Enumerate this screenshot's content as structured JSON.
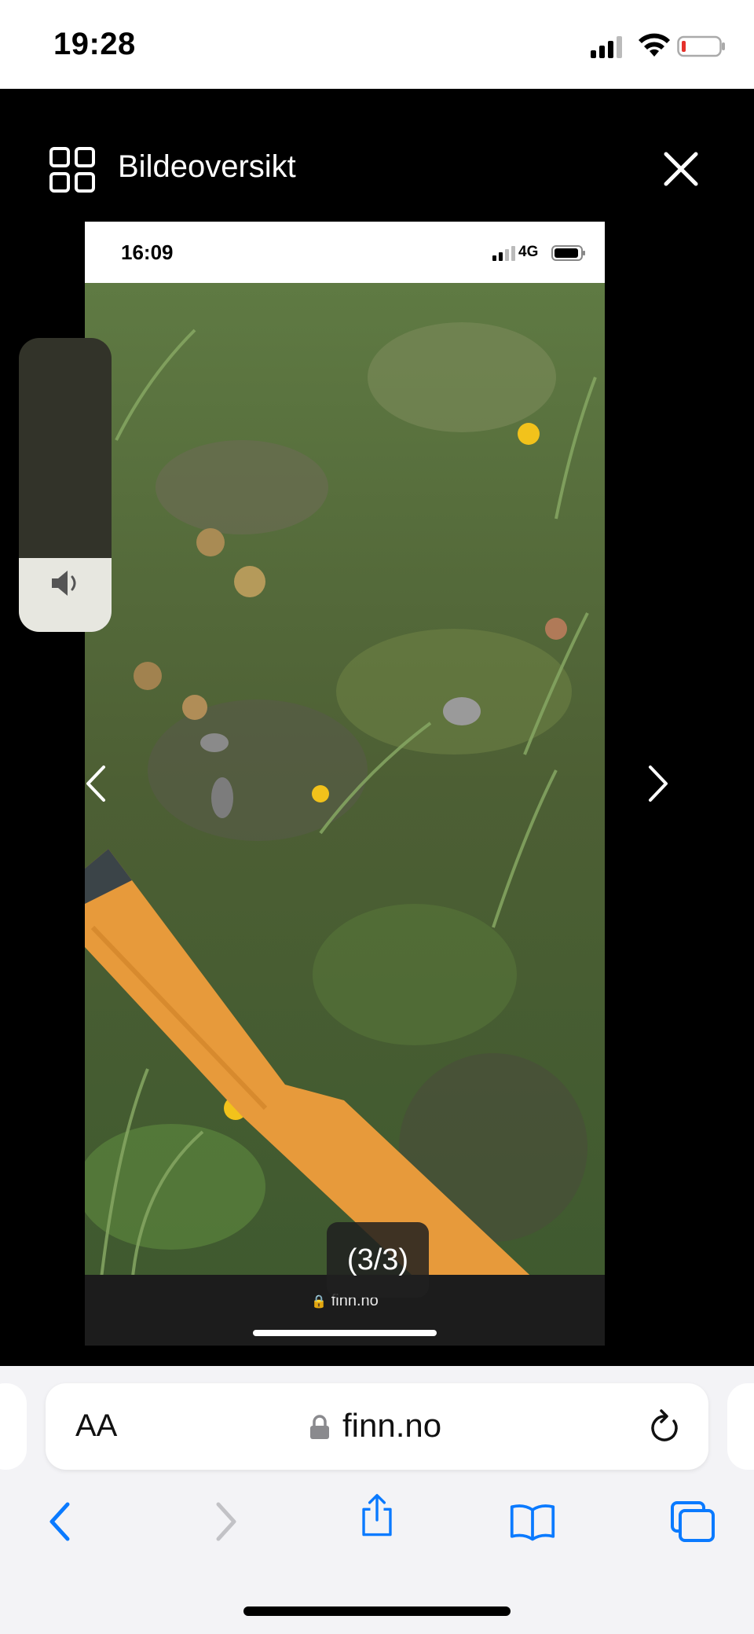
{
  "status_bar": {
    "time": "19:28"
  },
  "viewer": {
    "title": "Bildeoversikt",
    "counter": "(3/3)"
  },
  "screenshot": {
    "status_time": "16:09",
    "network": "4G",
    "url": "finn.no"
  },
  "volume": {
    "level": 0.25
  },
  "safari": {
    "aa_label": "AA",
    "url": "finn.no"
  },
  "colors": {
    "accent": "#0a7aff",
    "background_dark": "#000000",
    "toolbar_bg": "#f3f3f6"
  }
}
